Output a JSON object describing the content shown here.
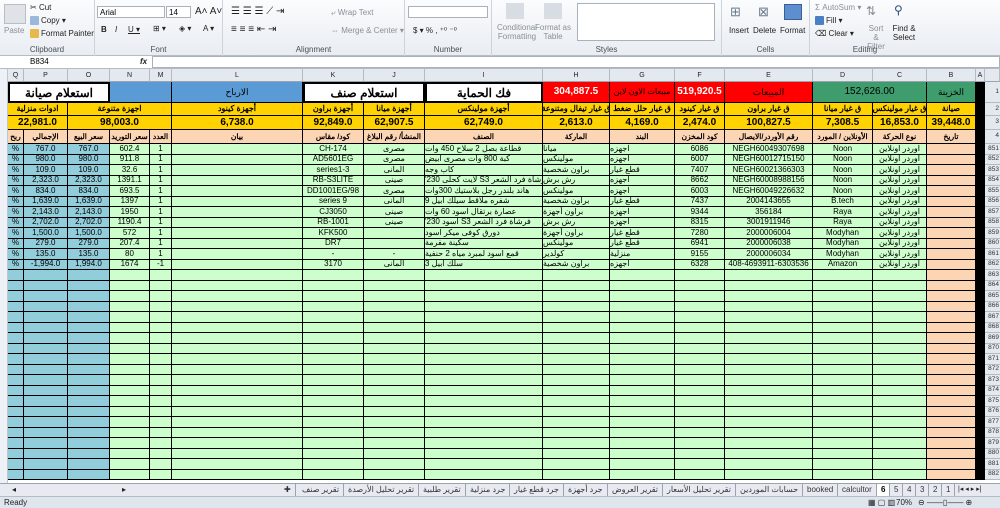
{
  "ribbon": {
    "clipboard": {
      "paste": "Paste",
      "cut": "Cut",
      "copy": "Copy",
      "format_painter": "Format Painter",
      "label": "Clipboard"
    },
    "font": {
      "name": "Arial",
      "size": "14",
      "label": "Font"
    },
    "alignment": {
      "wrap_text": "Wrap Text",
      "merge_center": "Merge & Center",
      "label": "Alignment"
    },
    "number": {
      "format": "",
      "label": "Number"
    },
    "styles": {
      "conditional": "Conditional Formatting",
      "format_table": "Format as Table",
      "label": "Styles"
    },
    "cells": {
      "insert": "Insert",
      "delete": "Delete",
      "format": "Format",
      "label": "Cells"
    },
    "editing": {
      "autosum": "AutoSum",
      "fill": "Fill",
      "clear": "Clear",
      "sort": "Sort & Filter",
      "find": "Find & Select",
      "label": "Editing"
    }
  },
  "formula_bar": {
    "name_box": "B834",
    "fx": "fx",
    "value": ""
  },
  "columns": [
    "Q",
    "P",
    "O",
    "N",
    "M",
    "L",
    "K",
    "J",
    "I",
    "H",
    "G",
    "F",
    "E",
    "D",
    "C",
    "B",
    "A"
  ],
  "row1": {
    "maintenance_query": "استعلام صيانة",
    "profits": "الارباح",
    "item_query": "استعلام صنف",
    "unprotect": "فك الحماية",
    "online_sales_value": "304,887.5",
    "online_sales_label": "مبيعات الاون لاين",
    "sales_value": "519,920.5",
    "sales_label": "المبيعات",
    "treasury_value": "152,626.00",
    "treasury_label": "الخزينة"
  },
  "summary": [
    {
      "label": "ادوات منزلية",
      "value": "22,981.0"
    },
    {
      "label": "اجهزة متنوعة",
      "value": "98,003.0"
    },
    {
      "label": "أجهزة كينود",
      "value": "6,738.0"
    },
    {
      "label": "أجهزة براون",
      "value": "92,849.0"
    },
    {
      "label": "أجهزة ميانا",
      "value": "62,907.5"
    },
    {
      "label": "أجهزة مولينكس",
      "value": "62,749.0"
    },
    {
      "label": "ق غيار تيفال ومتنوعة",
      "value": "2,613.0"
    },
    {
      "label": "ق غيار حلل ضغط",
      "value": "4,169.0"
    },
    {
      "label": "ق غيار كينود",
      "value": "2,474.0"
    },
    {
      "label": "ق غيار براون",
      "value": "100,827.5"
    },
    {
      "label": "ق غيار ميانا",
      "value": "7,308.5"
    },
    {
      "label": "ق غيار مولينكس",
      "value": "16,853.0"
    },
    {
      "label": "صيانة",
      "value": "39,448.0"
    }
  ],
  "headers": [
    "ربح",
    "الإجمالي",
    "سعر البيع",
    "سعر التوريد",
    "العدد",
    "بيان",
    "كود/ مقاس",
    "المنشأ/ رقم البلاغ",
    "الصنف",
    "الماركة",
    "البند",
    "كود المخزن",
    "رقم الأوردر/الايصال",
    "الأونلاين / المورد",
    "نوع الحركة",
    "تاريخ"
  ],
  "rows": [
    [
      "%",
      "767.0",
      "767.0",
      "602.4",
      "1",
      "",
      "CH-174",
      "مصرى",
      "قطاعة بصل 2 سلاح 450 وات",
      "ميانا",
      "اجهزه",
      "6086",
      "NEGH60049307698",
      "Noon",
      "اوردر اونلاين",
      ""
    ],
    [
      "%",
      "980.0",
      "980.0",
      "911.8",
      "1",
      "",
      "AD5601EG",
      "مصرى",
      "كبة 800 وات مصرى أبيض",
      "مولينكس",
      "اجهزه",
      "6007",
      "NEGH60012715150",
      "Noon",
      "اوردر اونلاين",
      ""
    ],
    [
      "%",
      "109.0",
      "109.0",
      "32.6",
      "1",
      "",
      "series1-3",
      "المانى",
      "كاب وجه",
      "براون شخصية",
      "قطع غيار",
      "7407",
      "NEGH60021366303",
      "Noon",
      "اوردر اونلاين",
      ""
    ],
    [
      "%",
      "2,323.0",
      "2,323.0",
      "1391.1",
      "1",
      "",
      "RB-S3LITE",
      "صينى",
      "فرشاة فرد الشعر S3 لايت كحلى 230'",
      "رش برش",
      "اجهزه",
      "8662",
      "NEGH60008988156",
      "Noon",
      "اوردر اونلاين",
      ""
    ],
    [
      "%",
      "834.0",
      "834.0",
      "693.5",
      "1",
      "",
      "DD1001EG/98",
      "مصرى",
      "هاند بلندر رجل بلاستيك 300وات",
      "مولينكس",
      "اجهزه",
      "6003",
      "NEGH60049226632",
      "Noon",
      "اوردر اونلاين",
      ""
    ],
    [
      "%",
      "1,639.0",
      "1,639.0",
      "1397",
      "1",
      "",
      "series 9",
      "المانى",
      "شفره ملاقط سيلك ابيل 9",
      "براون شخصية",
      "قطع غيار",
      "7437",
      "2004143655",
      "B.tech",
      "اوردر اونلاين",
      ""
    ],
    [
      "%",
      "2,143.0",
      "2,143.0",
      "1950",
      "1",
      "",
      "CJ3050",
      "صينى",
      "عصارة برتقال اسود 60 وات",
      "براون أجهزة",
      "اجهزه",
      "9344",
      "356184",
      "Raya",
      "اوردر اونلاين",
      ""
    ],
    [
      "%",
      "2,702.0",
      "2,702.0",
      "1190.4",
      "1",
      "",
      "RB-1001",
      "صينى",
      "فرشاة فرد الشعر S3 اسود 230'",
      "رش برش",
      "اجهزه",
      "8315",
      "3001911946",
      "Raya",
      "اوردر اونلاين",
      ""
    ],
    [
      "%",
      "1,500.0",
      "1,500.0",
      "572",
      "1",
      "",
      "KFK500",
      "",
      "دورق كوفى ميكر اسود",
      "براون أجهزة",
      "قطع غيار",
      "7280",
      "2000006004",
      "Modyhan",
      "اوردر اونلاين",
      ""
    ],
    [
      "%",
      "279.0",
      "279.0",
      "207.4",
      "1",
      "",
      "DR7",
      "",
      "سكينة مفرمة",
      "مولينكس",
      "قطع غيار",
      "6941",
      "2000006038",
      "Modyhan",
      "اوردر اونلاين",
      ""
    ],
    [
      "%",
      "135.0",
      "135.0",
      "80",
      "1",
      "",
      "-",
      "-",
      "قمع اسود لمبرد مياه 2 حنفية",
      "كولدير",
      "منزلية",
      "9155",
      "2000006034",
      "Modyhan",
      "اوردر اونلاين",
      ""
    ],
    [
      "%",
      "-1,994.0",
      "1,994.0",
      "1674",
      "-1",
      "",
      "3170",
      "المانى",
      "سلك ابيل 3",
      "براون شخصية",
      "اجهزه",
      "6328",
      "408-4693911-6303536",
      "Amazon",
      "اوردر اونلاين",
      ""
    ]
  ],
  "first_row_number": 851,
  "last_row_number": 882,
  "header_row_numbers": [
    "1",
    "2",
    "3",
    "4"
  ],
  "sheet_tabs": [
    "تقرير صنف",
    "تقرير تحليل الأرصدة",
    "تقرير طلبية",
    "جرد منزلية",
    "جرد قطع غيار",
    "جرد أجهزة",
    "تقرير العروض",
    "تقرير تحليل الأسعار",
    "حسابات الموردين",
    "booked",
    "calcultor",
    "6",
    "5",
    "4",
    "3",
    "2",
    "1"
  ],
  "active_tab": "6",
  "status": {
    "ready": "Ready",
    "zoom": "70%"
  },
  "colors": {
    "green": "#ccffcc",
    "peach": "#fcd5b4",
    "blue": "#92cddc",
    "yellow": "#ffd200",
    "red": "#ff0000",
    "dark_green": "#3f9c6c",
    "steel_blue": "#5b9bd5"
  }
}
